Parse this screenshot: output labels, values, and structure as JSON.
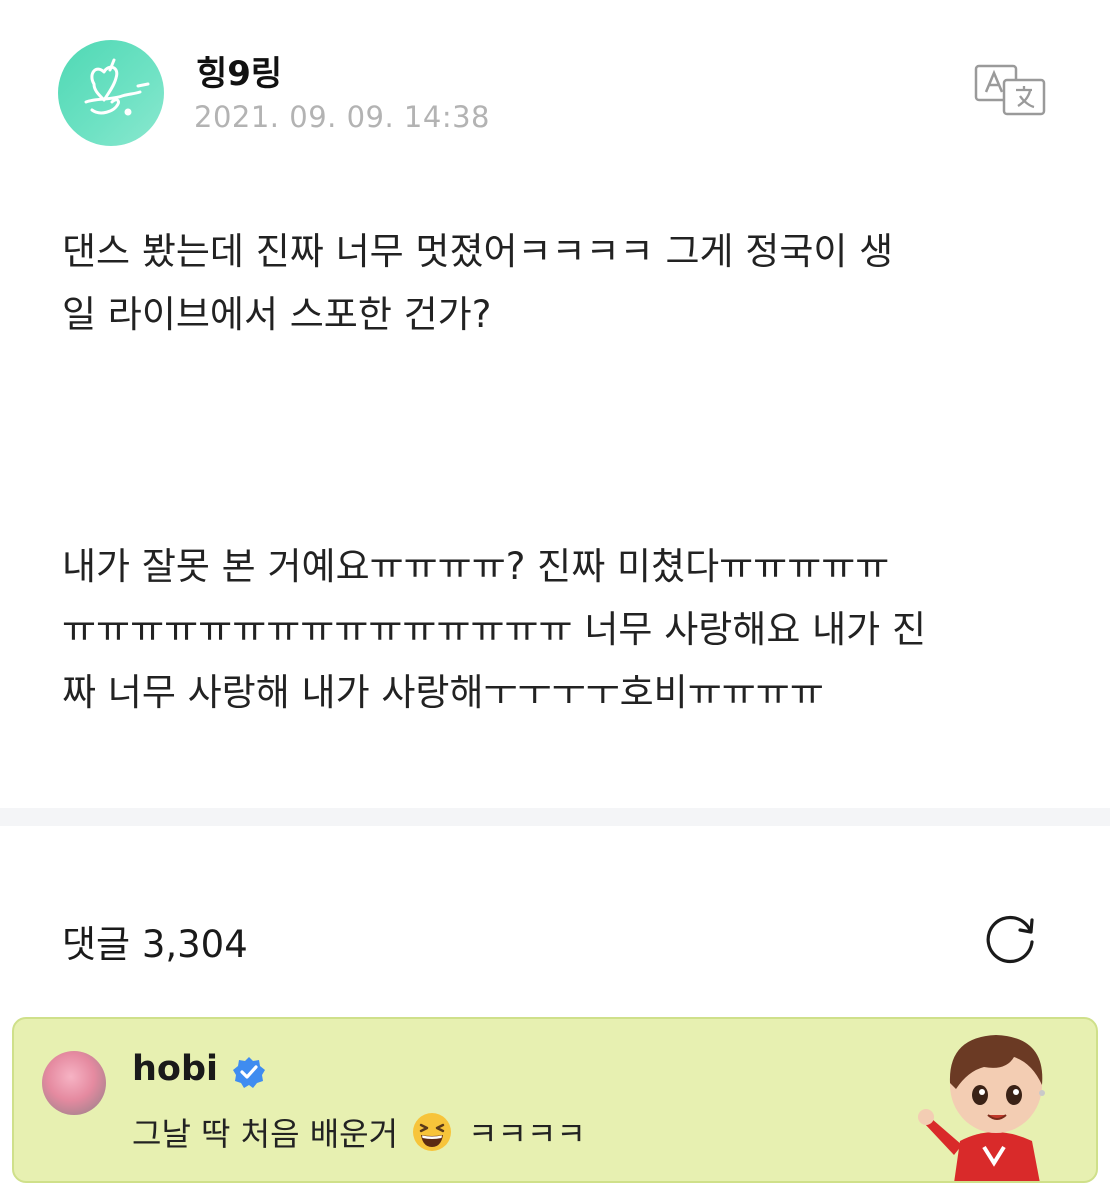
{
  "post": {
    "author": "힝9링",
    "date": "2021. 09. 09. 14:38",
    "paragraph_1": "댄스 봤는데 진짜 너무 멋졌어ㅋㅋㅋㅋ 그게 정국이 생\n일 라이브에서 스포한 건가?",
    "paragraph_2": "내가 잘못 본 거예요ㅠㅠㅠㅠ? 진짜 미쳤다ㅠㅠㅠㅠㅠ\nㅠㅠㅠㅠㅠㅠㅠㅠㅠㅠㅠㅠㅠㅠㅠ 너무 사랑해요 내가 진\n짜 너무 사랑해 내가 사랑해ㅜㅜㅜㅜ호비ㅠㅠㅠㅠ",
    "icons": {
      "avatar": "signature-logo-avatar",
      "translate": "translate-icon"
    }
  },
  "comments": {
    "label": "댓글 3,304",
    "refresh_icon": "refresh-icon"
  },
  "featured_comment": {
    "name": "hobi",
    "text_before": "그날 딱 처음 배운거",
    "text_after": "ㅋㅋㅋㅋ",
    "emoji": "grinning-squinting-face",
    "verified_icon": "verified-badge-icon",
    "sticker": "character-sticker",
    "colors": {
      "background": "#e7f0b1",
      "border": "#cfe08a",
      "verified": "#3f8cf0"
    }
  }
}
